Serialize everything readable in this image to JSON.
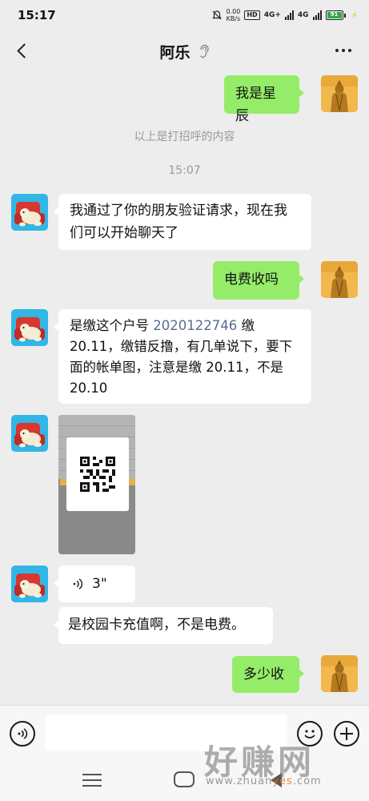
{
  "status_bar": {
    "time": "15:17",
    "net_speed_value": "0.00",
    "net_speed_unit": "KB/s",
    "hd_badge": "HD",
    "network_1": "4G+",
    "network_2": "4G",
    "battery_level": "91",
    "icons": [
      "mute-icon",
      "hd-icon",
      "signal-icon",
      "battery-icon",
      "charging-icon"
    ]
  },
  "header": {
    "contact_name": "阿乐",
    "icons": [
      "back-icon",
      "ear-icon",
      "more-icon"
    ]
  },
  "messages": [
    {
      "side": "right",
      "type": "text",
      "text": "我是星辰"
    },
    {
      "side": "system",
      "type": "note",
      "text": "以上是打招呼的内容"
    },
    {
      "side": "system",
      "type": "time",
      "text": "15:07"
    },
    {
      "side": "left",
      "type": "text",
      "text": "我通过了你的朋友验证请求，现在我们可以开始聊天了"
    },
    {
      "side": "right",
      "type": "text",
      "text": "电费收吗"
    },
    {
      "side": "left",
      "type": "text",
      "text_before": "是缴这个户号 ",
      "link": "2020122746",
      "text_after": " 缴20.11，缴错反撸，有几单说下，要下面的帐单图，注意是缴 20.11，不是 20.10"
    },
    {
      "side": "left",
      "type": "image",
      "description_icon": "qr-code-icon"
    },
    {
      "side": "left",
      "type": "voice",
      "duration": "3\""
    },
    {
      "side": "left",
      "type": "text",
      "text": "是校园卡充值啊，不是电费。"
    },
    {
      "side": "right",
      "type": "text",
      "text": "多少收"
    }
  ],
  "input_bar": {
    "placeholder": "",
    "icons": [
      "voice-input-icon",
      "emoji-icon",
      "plus-icon"
    ]
  },
  "nav_bar": {
    "icons": [
      "menu-icon",
      "home-icon",
      "back-nav-icon"
    ]
  },
  "watermark": {
    "text": "好赚网",
    "url_prefix": "www.zhuan",
    "url_accent": "yes",
    "url_suffix": ".com"
  },
  "colors": {
    "background": "#ededed",
    "my_bubble": "#95ec69",
    "other_bubble": "#ffffff",
    "link": "#576b95",
    "system_text": "#9a9a9a"
  }
}
